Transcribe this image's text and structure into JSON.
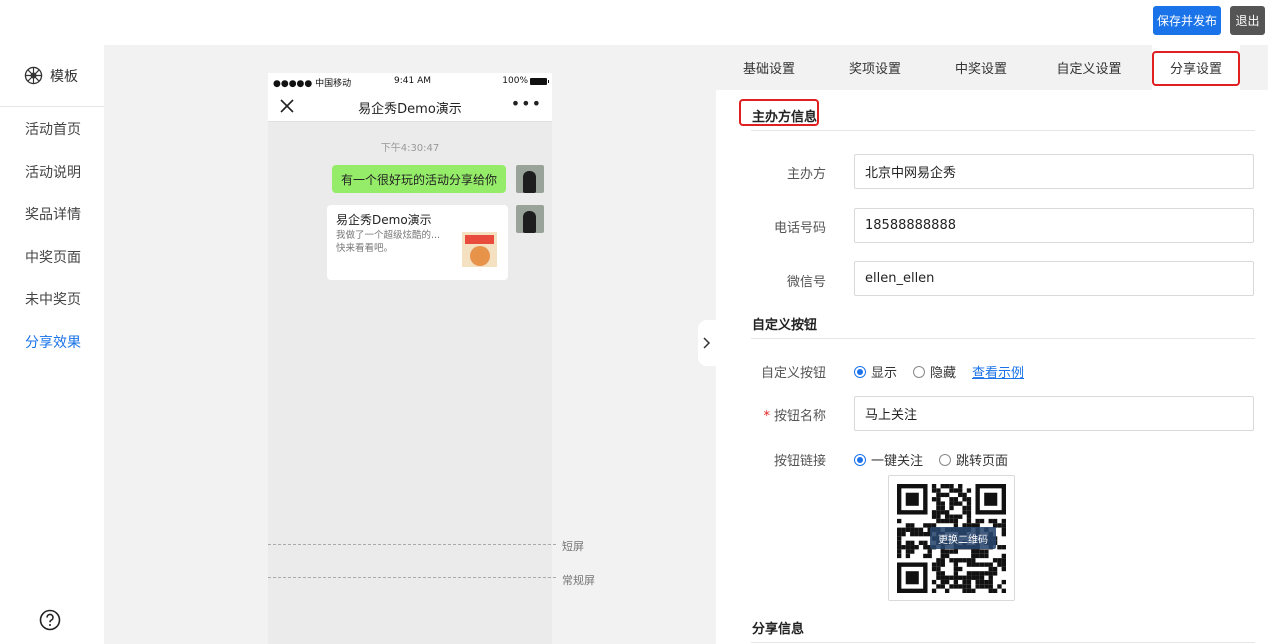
{
  "topbar": {
    "publish_label": "保存并发布",
    "exit_label": "退出"
  },
  "sidebar": {
    "template_label": "模板",
    "items": [
      {
        "label": "活动首页",
        "active": false
      },
      {
        "label": "活动说明",
        "active": false
      },
      {
        "label": "奖品详情",
        "active": false
      },
      {
        "label": "中奖页面",
        "active": false
      },
      {
        "label": "未中奖页",
        "active": false
      },
      {
        "label": "分享效果",
        "active": true
      }
    ],
    "help_icon": "question-circle-icon"
  },
  "phone": {
    "status": {
      "carrier": "●●●●● 中国移动 ",
      "time": "9:41 AM",
      "battery": "100%"
    },
    "nav_title": "易企秀Demo演示",
    "chat_time": "下午4:30:47",
    "message": "有一个很好玩的活动分享给你",
    "card": {
      "title": "易企秀Demo演示",
      "desc": "我做了一个超级炫酷的...\n快来看看吧。"
    },
    "short_screen_label": "短屏",
    "normal_screen_label": "常规屏"
  },
  "tabs": [
    {
      "label": "基础设置",
      "active": false
    },
    {
      "label": "奖项设置",
      "active": false
    },
    {
      "label": "中奖设置",
      "active": false
    },
    {
      "label": "自定义设置",
      "active": false
    },
    {
      "label": "分享设置",
      "active": true
    }
  ],
  "organizer": {
    "section_title": "主办方信息",
    "organizer_label": "主办方",
    "organizer_value": "北京中网易企秀",
    "phone_label": "电话号码",
    "phone_value": "18588888888",
    "wechat_label": "微信号",
    "wechat_value": "ellen_ellen"
  },
  "custom_button": {
    "section_title": "自定义按钮",
    "toggle_label": "自定义按钮",
    "show_label": "显示",
    "hide_label": "隐藏",
    "example_link": "查看示例",
    "name_label": "按钮名称",
    "name_value": "马上关注",
    "link_label": "按钮链接",
    "follow_label": "一键关注",
    "jump_label": "跳转页面",
    "replace_qr_label": "更换二维码"
  },
  "share_info": {
    "section_title": "分享信息"
  },
  "colors": {
    "accent": "#1a73e8",
    "highlight": "#e02020",
    "chat_bubble": "#95ec69"
  }
}
